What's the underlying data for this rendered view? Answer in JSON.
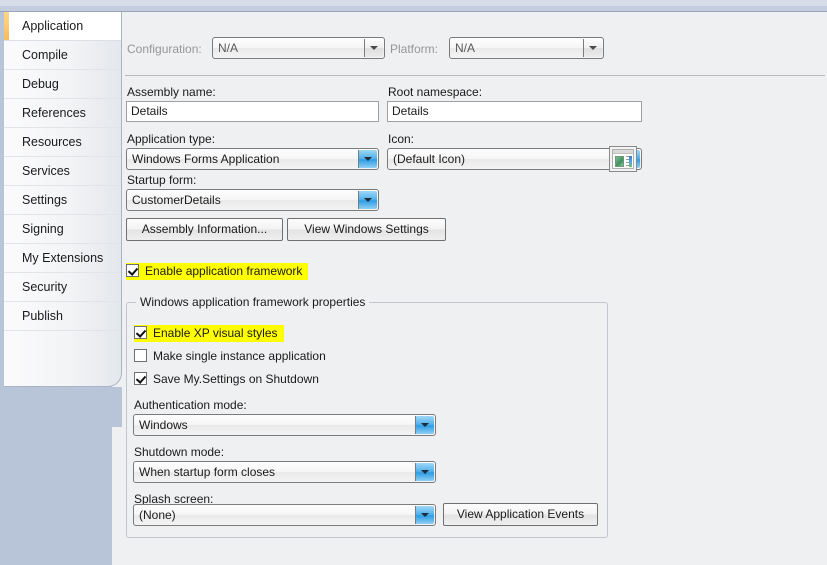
{
  "sidebar": {
    "items": [
      {
        "label": "Application",
        "selected": true
      },
      {
        "label": "Compile",
        "selected": false
      },
      {
        "label": "Debug",
        "selected": false
      },
      {
        "label": "References",
        "selected": false
      },
      {
        "label": "Resources",
        "selected": false
      },
      {
        "label": "Services",
        "selected": false
      },
      {
        "label": "Settings",
        "selected": false
      },
      {
        "label": "Signing",
        "selected": false
      },
      {
        "label": "My Extensions",
        "selected": false
      },
      {
        "label": "Security",
        "selected": false
      },
      {
        "label": "Publish",
        "selected": false
      }
    ]
  },
  "topbar": {
    "configuration_label": "Configuration:",
    "configuration_value": "N/A",
    "platform_label": "Platform:",
    "platform_value": "N/A"
  },
  "form": {
    "assembly_name_label": "Assembly name:",
    "assembly_name_value": "Details",
    "root_namespace_label": "Root namespace:",
    "root_namespace_value": "Details",
    "application_type_label": "Application type:",
    "application_type_value": "Windows Forms Application",
    "icon_label": "Icon:",
    "icon_value": "(Default Icon)",
    "icon_preview_name": "application-icon-preview",
    "startup_form_label": "Startup form:",
    "startup_form_value": "CustomerDetails",
    "assembly_information_button": "Assembly Information...",
    "view_windows_settings_button": "View Windows Settings",
    "enable_application_framework_label": "Enable application framework",
    "enable_application_framework_checked": true,
    "enable_application_framework_highlighted": true
  },
  "framework_group": {
    "legend": "Windows application framework properties",
    "checkboxes": [
      {
        "label": "Enable XP visual styles",
        "checked": true,
        "highlighted": true
      },
      {
        "label": "Make single instance application",
        "checked": false,
        "highlighted": false
      },
      {
        "label": "Save My.Settings on Shutdown",
        "checked": true,
        "highlighted": false
      }
    ],
    "authentication_mode_label": "Authentication mode:",
    "authentication_mode_value": "Windows",
    "shutdown_mode_label": "Shutdown mode:",
    "shutdown_mode_value": "When startup form closes",
    "splash_screen_label": "Splash screen:",
    "splash_screen_value": "(None)",
    "view_application_events_button": "View Application Events"
  },
  "colors": {
    "highlight": "#ffff00",
    "sidebar_background": "#b8c4d8",
    "selected_tab_accent": "#f7bd5a",
    "panel_background": "#eff0f1",
    "combo_arrow_blue": "#2f9de4"
  }
}
